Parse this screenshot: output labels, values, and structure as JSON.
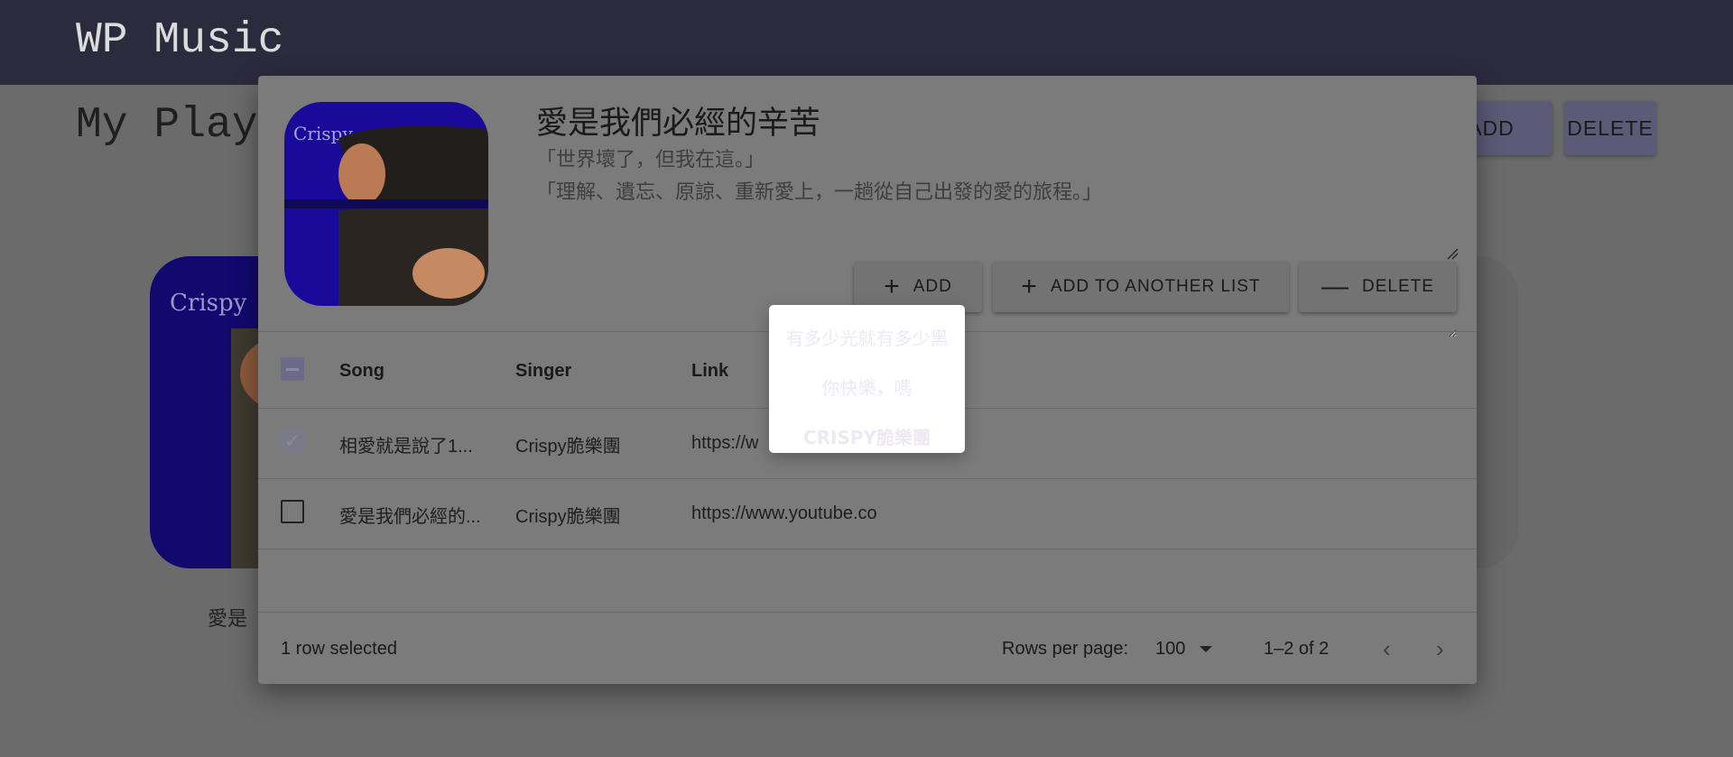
{
  "app": {
    "title": "WP Music"
  },
  "page": {
    "heading": "My Play",
    "add_label": "ADD",
    "delete_label": "DELETE",
    "card_title": "愛是"
  },
  "dialog": {
    "playlist_name": "愛是我們必經的辛苦",
    "description_lines": [
      "「世界壞了，但我在這。」",
      "「理解、遺忘、原諒、重新愛上，一趟從自己出發的愛的旅程。」"
    ],
    "buttons": {
      "add": "ADD",
      "add_to_another_list": "ADD TO ANOTHER LIST",
      "delete": "DELETE"
    },
    "icons": {
      "add": "plus-icon",
      "add_another": "plus-icon",
      "delete": "minus-icon"
    },
    "table": {
      "columns": [
        "Song",
        "Singer",
        "Link"
      ],
      "rows": [
        {
          "song": "相愛就是說了1...",
          "singer": "Crispy脆樂團",
          "link": "https://w",
          "selected": true
        },
        {
          "song": "愛是我們必經的...",
          "singer": "Crispy脆樂團",
          "link": "https://www.youtube.co",
          "selected": false
        }
      ]
    },
    "footer": {
      "selection": "1 row selected",
      "rows_per_page_label": "Rows per page:",
      "rows_per_page_value": "100",
      "range": "1–2 of 2",
      "prev_icon": "chevron-left-icon",
      "next_icon": "chevron-right-icon"
    }
  },
  "popup_menu": {
    "items": [
      "有多少光就有多少黑",
      "你快樂，嗎",
      "CRISPY脆樂團"
    ]
  },
  "colors": {
    "appbar": "#2c2a3d",
    "album_blue": "#1a0a9a",
    "accent_purple": "#5d5a78"
  }
}
